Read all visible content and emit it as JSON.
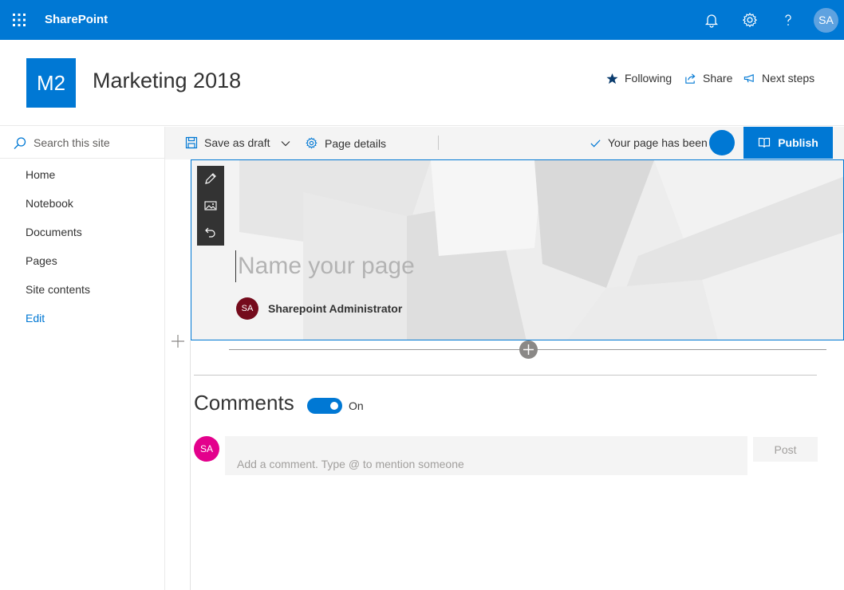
{
  "suite_bar": {
    "app_name": "SharePoint",
    "icons": [
      "waffle-icon",
      "bell-icon",
      "gear-icon",
      "help-icon"
    ],
    "user_initials": "SA",
    "color": "#0078d4"
  },
  "site": {
    "logo_text": "M2",
    "title": "Marketing 2018",
    "actions": [
      {
        "label": "Following",
        "icon": "star-icon"
      },
      {
        "label": "Share",
        "icon": "share-icon"
      },
      {
        "label": "Next steps",
        "icon": "megaphone-icon"
      }
    ]
  },
  "left_nav": {
    "search_placeholder": "Search this site",
    "items": [
      "Home",
      "Notebook",
      "Documents",
      "Pages",
      "Site contents"
    ],
    "edit_label": "Edit"
  },
  "command_bar": {
    "save_draft": "Save as draft",
    "page_details": "Page details",
    "status": "Your page has been s",
    "publish": "Publish"
  },
  "title_area": {
    "title_placeholder": "Name your page",
    "author_initials": "SA",
    "author_name": "Sharepoint Administrator"
  },
  "comments": {
    "heading": "Comments",
    "toggle_state": "On",
    "toggle_on": true,
    "user_initials": "SA",
    "input_placeholder": "Add a comment. Type @ to mention someone",
    "post_label": "Post"
  }
}
